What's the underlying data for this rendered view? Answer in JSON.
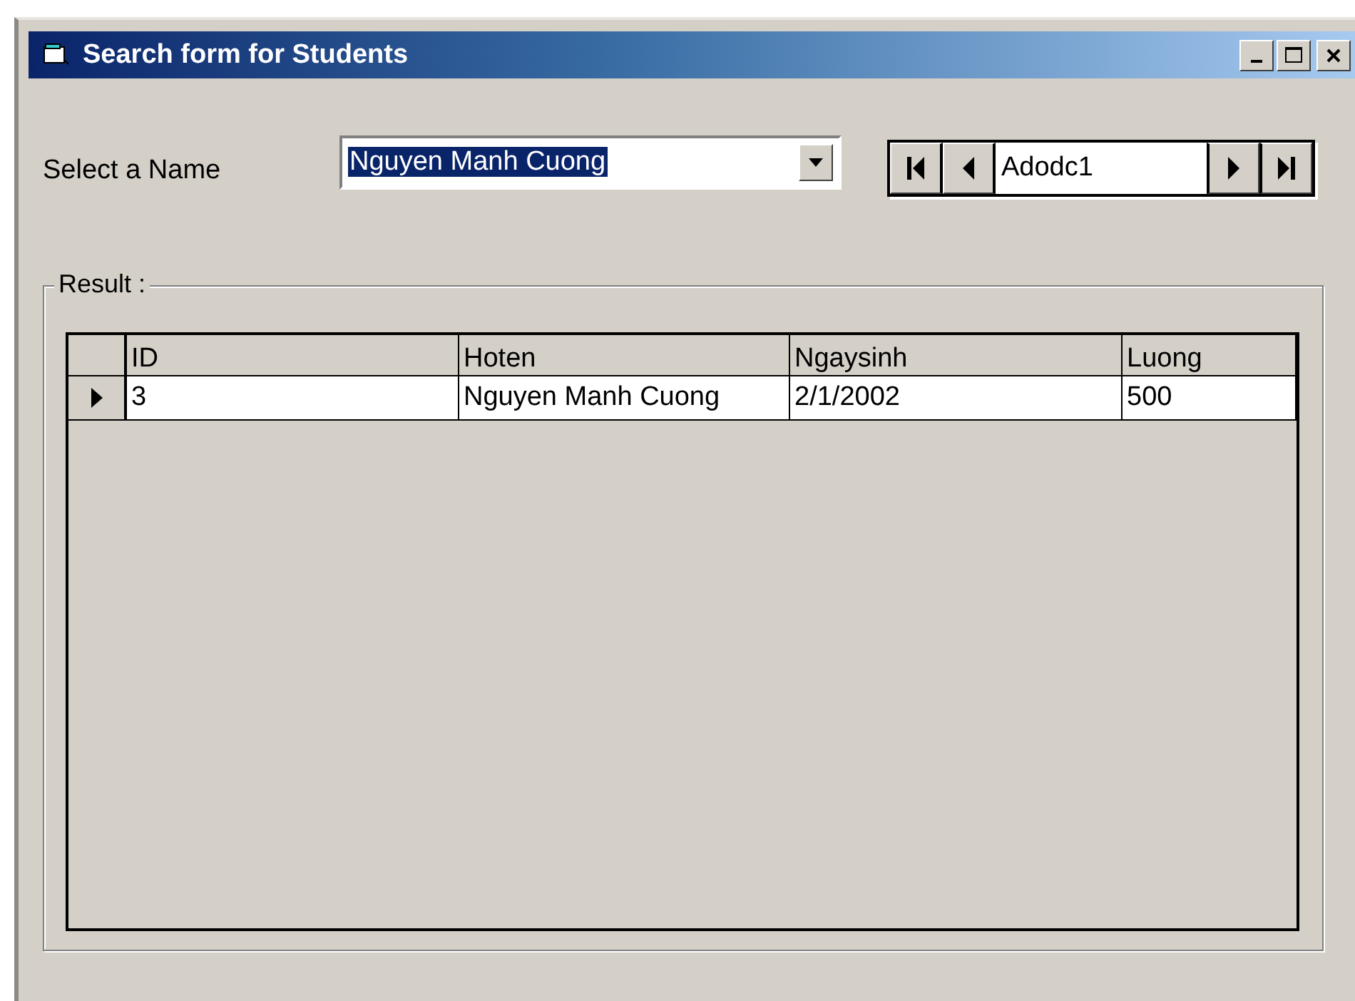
{
  "window": {
    "title": "Search form for Students"
  },
  "select_label": "Select a Name",
  "name_combo": {
    "value": "Nguyen Manh Cuong",
    "selected": true
  },
  "navigator": {
    "caption": "Adodc1"
  },
  "result_group": {
    "title": "Result :"
  },
  "table": {
    "columns": [
      "ID",
      "Hoten",
      "Ngaysinh",
      "Luong"
    ],
    "rows": [
      {
        "current": true,
        "cells": [
          "3",
          "Nguyen Manh Cuong",
          "2/1/2002",
          "500"
        ]
      }
    ]
  }
}
